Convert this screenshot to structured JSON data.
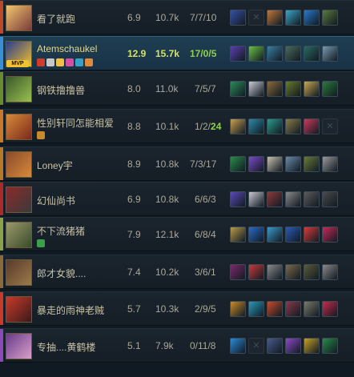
{
  "scoreboard": {
    "players": [
      {
        "name": "看了就跑",
        "score": "6.9",
        "gold": "10.7k",
        "kda": [
          "7/7/10"
        ],
        "portrait": [
          "#f2c66d",
          "#7a3a3a"
        ],
        "stripe": "#bb4a2a",
        "items": [
          "#3850a8",
          "empty",
          "#c0783a",
          "#3aa7c9",
          "#2877c8",
          "#5a7a3a"
        ]
      },
      {
        "name": "Atemschaukel",
        "score": "12.9",
        "gold": "15.7k",
        "kda": [
          "17/0/5"
        ],
        "highlight": true,
        "badge": "MVP",
        "portrait": [
          "#2a3d8a",
          "#f2c12e"
        ],
        "stripe": "#3a8fd4",
        "tags": [
          "#d23b2b",
          "#c8c8c8",
          "#f0c040",
          "#d84ea5",
          "#3ba0c8",
          "#e08a3a"
        ],
        "items": [
          "#5a3fb0",
          "#6bbf45",
          "#3a7fa0",
          "#4a6a5a",
          "#2a6a60",
          "#7a9ab0"
        ]
      },
      {
        "name": "钢铁撸撸兽",
        "score": "8.0",
        "gold": "11.0k",
        "kda": [
          "7/5/7"
        ],
        "portrait": [
          "#3a5a2a",
          "#9ac050"
        ],
        "stripe": "#6a8a30",
        "items": [
          "#2a8a5a",
          "#c8c8d0",
          "#8a6a3a",
          "#6a7a2a",
          "#c8a850",
          "#2a7a3a"
        ]
      },
      {
        "name": "性别轩同怎能相爱",
        "score": "8.8",
        "gold": "10.1k",
        "kda": [
          "1/2/",
          "24"
        ],
        "portrait": [
          "#d88a3a",
          "#7a2a1a"
        ],
        "stripe": "#c8782a",
        "tags": [
          "#c88a2a"
        ],
        "items": [
          "#c8a050",
          "#2a8aa8",
          "#2a9a8a",
          "#8a7a4a",
          "#c83a5a",
          "empty"
        ]
      },
      {
        "name": "Loney宇",
        "score": "8.9",
        "gold": "10.8k",
        "kda": [
          "7/3/17"
        ],
        "portrait": [
          "#8a4a2a",
          "#d88a3a"
        ],
        "stripe": "#b8782a",
        "items": [
          "#2a8a4a",
          "#7a4ac8",
          "#c8c0b0",
          "#6a8aa8",
          "#6a7a3a",
          "#9a9a9a"
        ]
      },
      {
        "name": "幻仙尚书",
        "score": "6.9",
        "gold": "10.8k",
        "kda": [
          "6/6/3"
        ],
        "portrait": [
          "#8a2a2a",
          "#3a3a3a"
        ],
        "stripe": "#aa2a2a",
        "items": [
          "#5a4ab8",
          "#c8c8d0",
          "#8a3a3a",
          "#8a8a8a",
          "#5a5a5a",
          "#4a4a4a"
        ]
      },
      {
        "name": "不下流猪猪",
        "score": "7.9",
        "gold": "12.1k",
        "kda": [
          "6/8/4"
        ],
        "portrait": [
          "#9a9a6a",
          "#3a4a2a"
        ],
        "stripe": "#8aa04a",
        "tags": [
          "#3aa04a"
        ],
        "items": [
          "#b89a4a",
          "#2a6ac8",
          "#3a9ac8",
          "#2a5ab8",
          "#d83a3a",
          "#c82a5a"
        ]
      },
      {
        "name": "郎才女貌....",
        "score": "7.4",
        "gold": "10.2k",
        "kda": [
          "3/6/1"
        ],
        "portrait": [
          "#5a3a2a",
          "#9a7a4a"
        ],
        "stripe": "#8a6a3a",
        "items": [
          "#7a2a6a",
          "#c83a3a",
          "#8a8a8a",
          "#7a6a4a",
          "#5a5a3a",
          "#8a8a8a"
        ]
      },
      {
        "name": "暴走的雨神老贼",
        "score": "5.7",
        "gold": "10.3k",
        "kda": [
          "2/9/5"
        ],
        "portrait": [
          "#c83a2a",
          "#3a1a1a"
        ],
        "stripe": "#c83a2a",
        "items": [
          "#c88a2a",
          "#2a9ab8",
          "#c84a2a",
          "#8a3a4a",
          "#7a7a6a",
          "#c82a4a"
        ]
      },
      {
        "name": "专抽....黄鹤楼",
        "score": "5.1",
        "gold": "7.9k",
        "kda": [
          "0/11/8"
        ],
        "portrait": [
          "#6a3a8a",
          "#d8a0c8"
        ],
        "stripe": "#8a4ab8",
        "items": [
          "#2a8ad8",
          "empty",
          "#4a5a8a",
          "#8a4ac8",
          "#c8a02a",
          "#2a8a4a"
        ]
      }
    ]
  }
}
